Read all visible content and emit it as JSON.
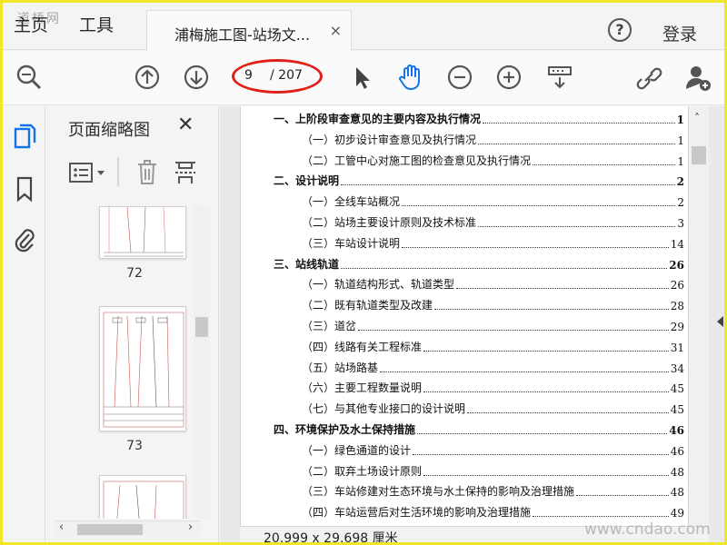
{
  "watermark_top": "道桥网",
  "tabs": {
    "home": "主页",
    "tools": "工具"
  },
  "document_tab": {
    "title": "浦梅施工图-站场文...",
    "close": "×"
  },
  "header": {
    "login": "登录",
    "help": "?"
  },
  "toolbar": {
    "page_current": "9",
    "page_total": "/ 207"
  },
  "thumbnail_panel": {
    "title": "页面缩略图",
    "close": "✕",
    "pages": [
      "72",
      "73"
    ]
  },
  "toc": [
    {
      "level": 1,
      "label": "一、上阶段审查意见的主要内容及执行情况",
      "page": "1"
    },
    {
      "level": 2,
      "label": "（一）初步设计审查意见及执行情况",
      "page": "1"
    },
    {
      "level": 2,
      "label": "（二）工管中心对施工图的检查意见及执行情况",
      "page": "1"
    },
    {
      "level": 1,
      "label": "二、设计说明",
      "page": "2"
    },
    {
      "level": 2,
      "label": "（一）全线车站概况",
      "page": "2"
    },
    {
      "level": 2,
      "label": "（二）站场主要设计原则及技术标准",
      "page": "3"
    },
    {
      "level": 2,
      "label": "（三）车站设计说明",
      "page": "14"
    },
    {
      "level": 1,
      "label": "三、站线轨道",
      "page": "26"
    },
    {
      "level": 2,
      "label": "（一）轨道结构形式、轨道类型",
      "page": "26"
    },
    {
      "level": 2,
      "label": "（二）既有轨道类型及改建",
      "page": "28"
    },
    {
      "level": 2,
      "label": "（三）道岔",
      "page": "29"
    },
    {
      "level": 2,
      "label": "（四）线路有关工程标准",
      "page": "31"
    },
    {
      "level": 2,
      "label": "（五）站场路基",
      "page": "34"
    },
    {
      "level": 2,
      "label": "（六）主要工程数量说明",
      "page": "45"
    },
    {
      "level": 2,
      "label": "（七）与其他专业接口的设计说明",
      "page": "45"
    },
    {
      "level": 1,
      "label": "四、环境保护及水土保持措施",
      "page": "46"
    },
    {
      "level": 2,
      "label": "（一）绿色通道的设计",
      "page": "46"
    },
    {
      "level": 2,
      "label": "（二）取弃土场设计原则",
      "page": "48"
    },
    {
      "level": 2,
      "label": "（三）车站修建对生态环境与水土保持的影响及治理措施",
      "page": "48"
    },
    {
      "level": 2,
      "label": "（四）车站运营后对生活环境的影响及治理措施",
      "page": "49"
    }
  ],
  "status": {
    "page_size": "20.999 x 29.698 厘米"
  },
  "watermark_bottom": "www.cndao.com",
  "colors": {
    "accent_blue": "#1473e6",
    "highlight_red": "#e0201a",
    "frame_yellow": "#f0e62a"
  }
}
